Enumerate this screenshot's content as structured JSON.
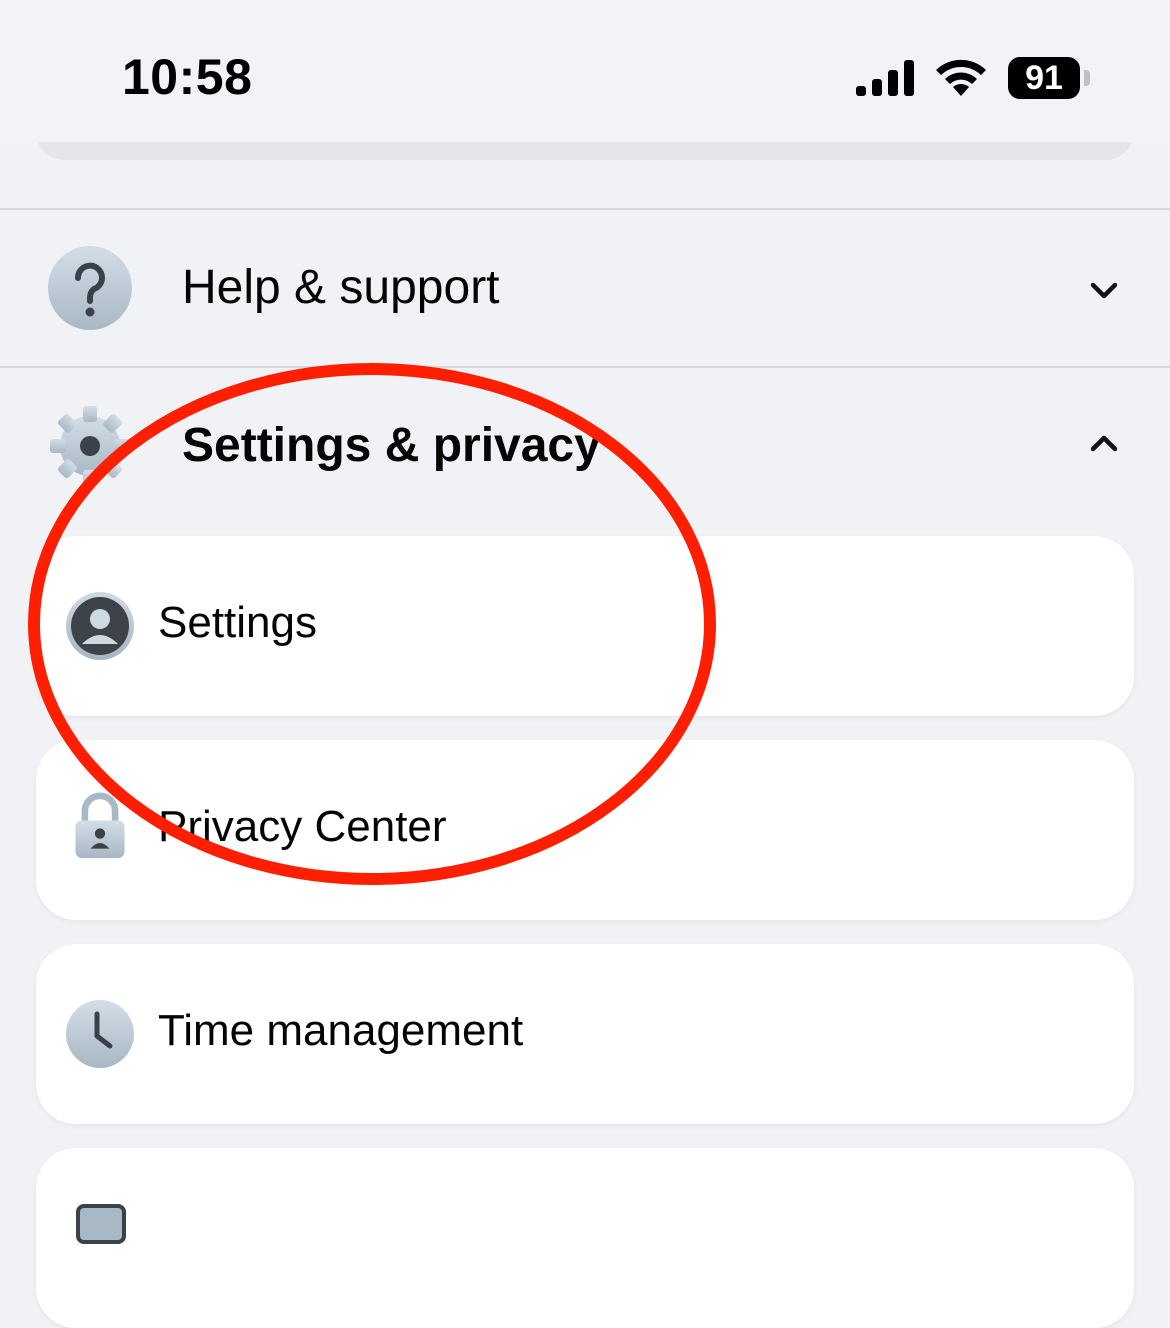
{
  "status_bar": {
    "time": "10:58",
    "battery_level": "91"
  },
  "sections": {
    "help": {
      "label": "Help & support",
      "icon": "question-icon",
      "state": "collapsed"
    },
    "settings_privacy": {
      "label": "Settings & privacy",
      "icon": "gear-icon",
      "state": "expanded"
    }
  },
  "menu_items": [
    {
      "label": "Settings",
      "icon": "account-icon"
    },
    {
      "label": "Privacy Center",
      "icon": "lock-icon"
    },
    {
      "label": "Time management",
      "icon": "clock-icon"
    },
    {
      "label": "",
      "icon": "device-icon"
    }
  ],
  "colors": {
    "background": "#f1f2f6",
    "card": "#ffffff",
    "icon_fill": "#b9c7d3",
    "annotation_circle": "#ff1f00"
  }
}
